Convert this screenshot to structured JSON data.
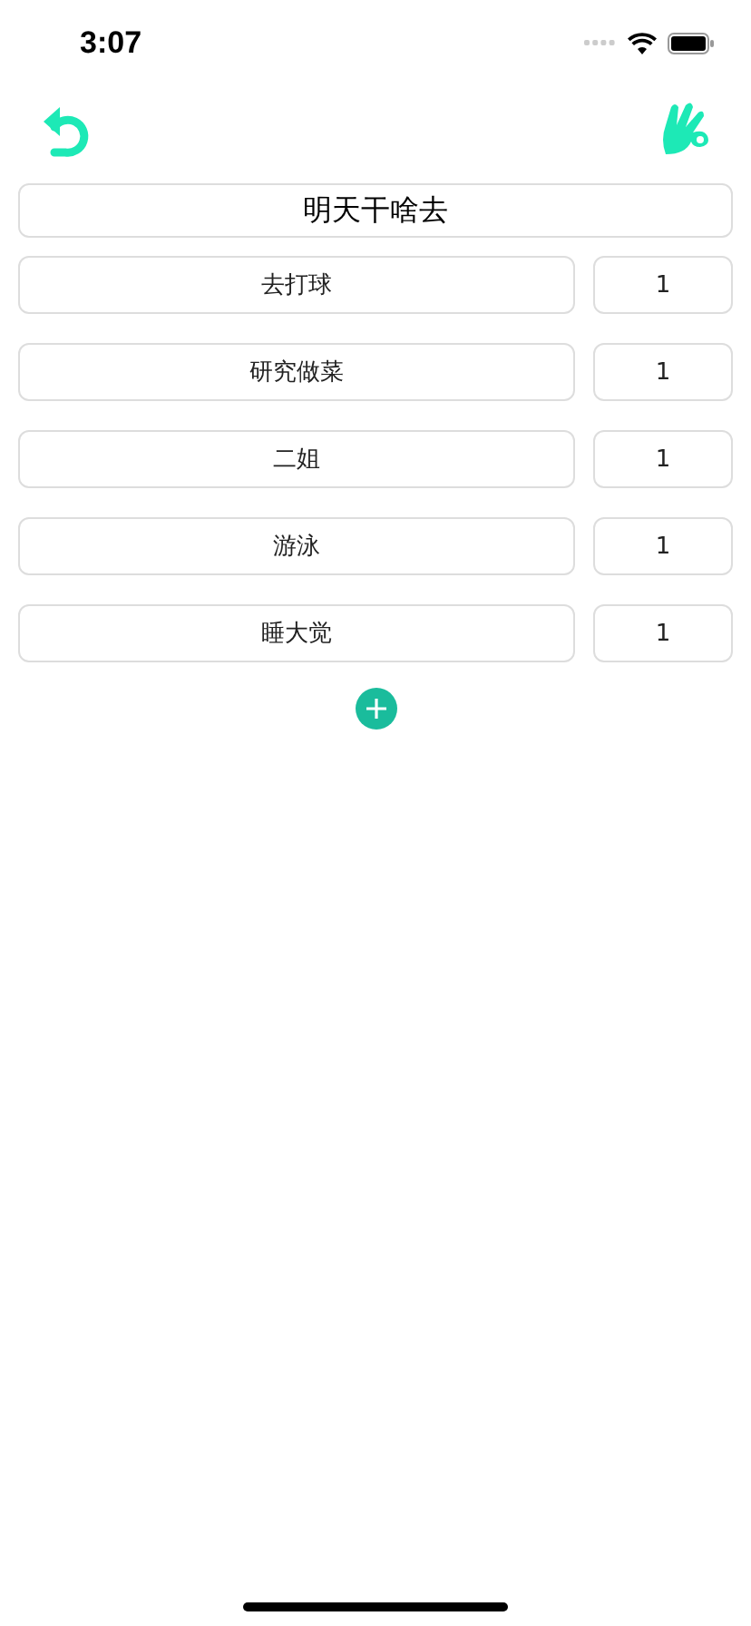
{
  "status_bar": {
    "time": "3:07"
  },
  "title": {
    "value": "明天干啥去"
  },
  "items": [
    {
      "name": "去打球",
      "count": "1"
    },
    {
      "name": "研究做菜",
      "count": "1"
    },
    {
      "name": "二姐",
      "count": "1"
    },
    {
      "name": "游泳",
      "count": "1"
    },
    {
      "name": "睡大觉",
      "count": "1"
    }
  ]
}
